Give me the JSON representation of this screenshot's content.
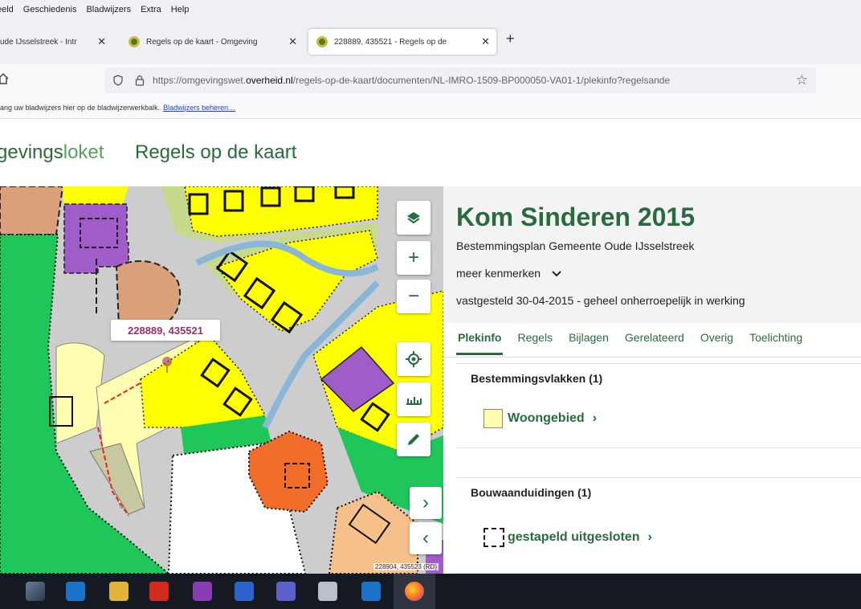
{
  "browser": {
    "menu": [
      "eeld",
      "Geschiedenis",
      "Bladwijzers",
      "Extra",
      "Help"
    ],
    "tabs": [
      {
        "label": "ude IJsselstreek - Intr"
      },
      {
        "label": "Regels op de kaart - Omgeving"
      },
      {
        "label": "228889, 435521 - Regels op de"
      }
    ],
    "new_tab_label": "+",
    "url": {
      "prefix": "https://omgevingswet.",
      "domain": "overheid.nl",
      "path": "/regels-op-de-kaart/documenten/NL-IMRO-1509-BP000050-VA01-1/plekinfo?regelsande"
    },
    "bookmarks": {
      "text": "ang uw bladwijzers hier op de bladwijzerwerkbalk.",
      "link": "Bladwijzers beheren…"
    }
  },
  "site": {
    "logo_bold": "gevings",
    "logo_light": "loket",
    "app_title": "Regels op de kaart"
  },
  "map": {
    "coord_label": "228889, 435521",
    "scale_coords": "228904, 435523 (RD)",
    "buttons": {
      "zoom_in": "+",
      "zoom_out": "−",
      "forward": "›",
      "back": "‹"
    }
  },
  "panel": {
    "title": "Kom Sinderen 2015",
    "subtitle": "Bestemmingsplan  Gemeente Oude IJsselstreek",
    "more": "meer kenmerken",
    "status": "vastgesteld 30-04-2015 - geheel onherroepelijk in werking",
    "tabs": [
      "Plekinfo",
      "Regels",
      "Bijlagen",
      "Gerelateerd",
      "Overig",
      "Toelichting"
    ],
    "sections": [
      {
        "title": "Bestemmingsvlakken (1)",
        "item": "Woongebied"
      },
      {
        "title": "Bouwaanduidingen (1)",
        "item": "gestapeld uitgesloten"
      }
    ]
  },
  "colors": {
    "accent": "#2a6b3d",
    "coord": "#9c2d6e",
    "residential_yellow": "#ffff00",
    "woongebied": "#fffeb0",
    "green": "#1fc75a",
    "purple": "#a05cc9",
    "orange": "#f26c2a"
  }
}
